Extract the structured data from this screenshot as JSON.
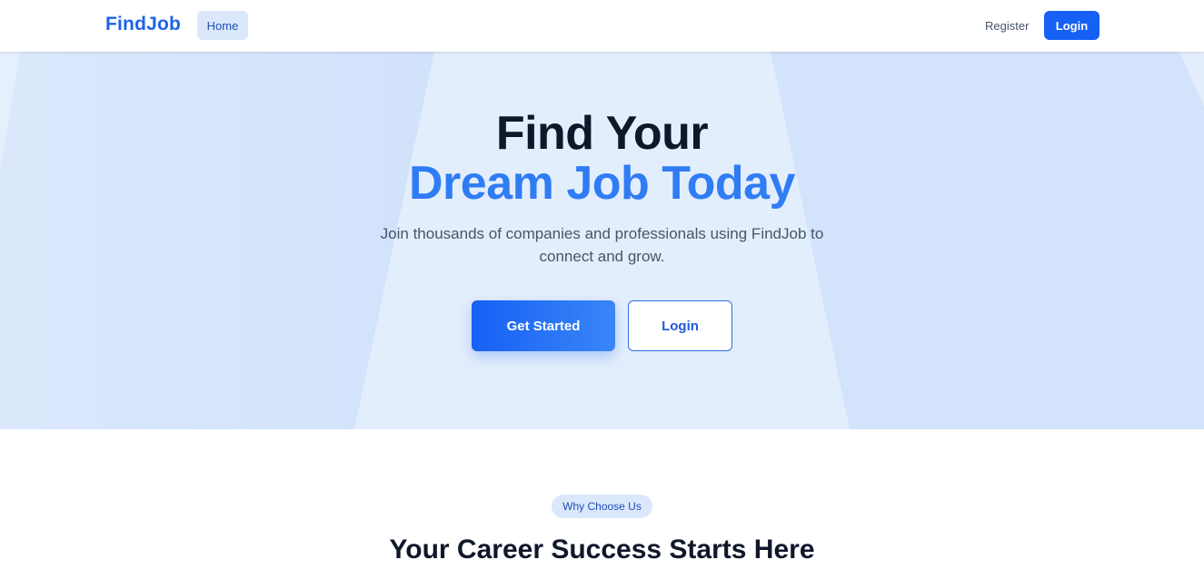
{
  "navbar": {
    "brand": "FindJob",
    "home_label": "Home",
    "register_label": "Register",
    "login_label": "Login"
  },
  "hero": {
    "title_line1": "Find Your",
    "title_line2": "Dream Job Today",
    "subtitle": "Join thousands of companies and professionals using FindJob to connect and grow.",
    "primary_button": "Get Started",
    "secondary_button": "Login"
  },
  "features": {
    "badge": "Why Choose Us",
    "title": "Your Career Success Starts Here"
  },
  "colors": {
    "brand": "#1d64e8",
    "primary": "#1660f5",
    "accent": "#2f7cf5",
    "hero_bg": "#d3e3fb",
    "text_dark": "#0f172a"
  }
}
